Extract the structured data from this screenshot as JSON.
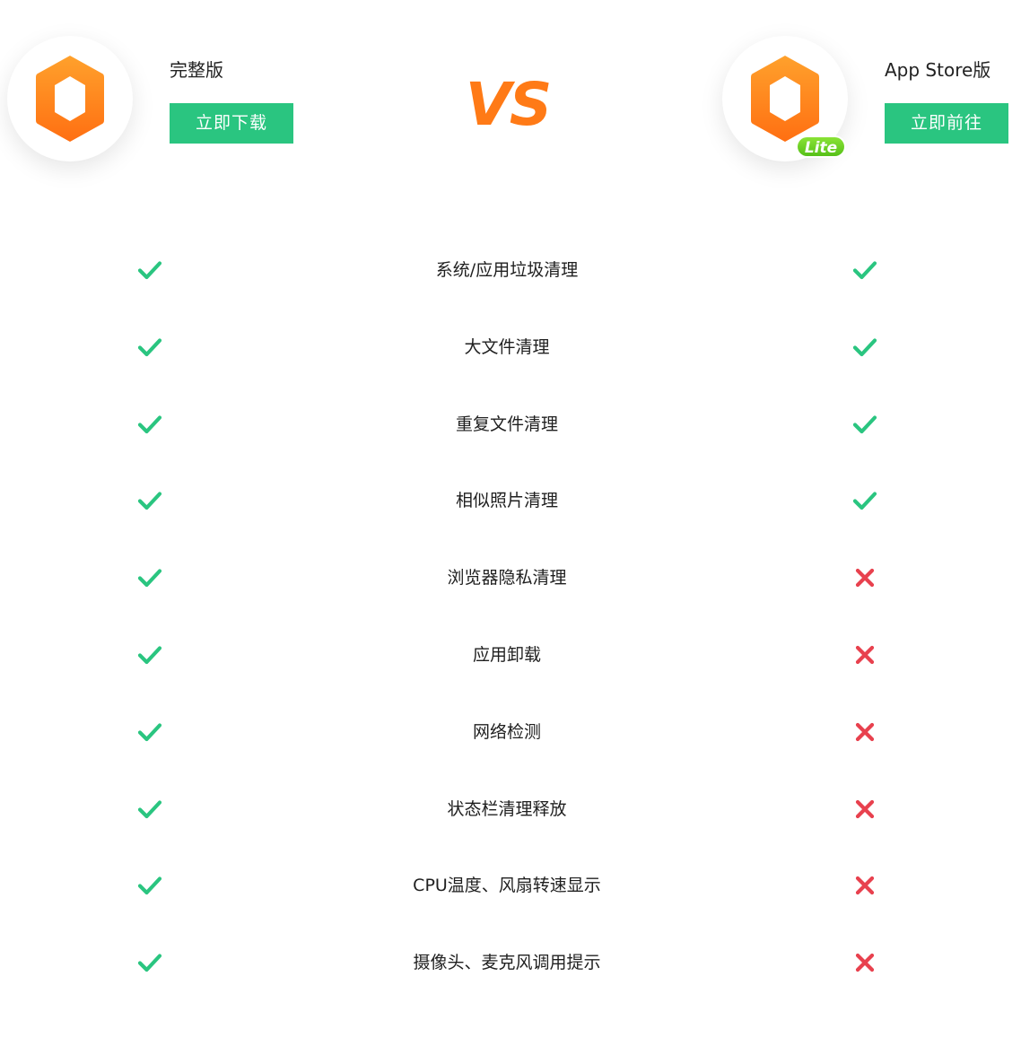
{
  "colors": {
    "accent_green": "#2ac580",
    "vs_orange": "#ff7a16",
    "check_green": "#2ac580",
    "cross_red": "#e8414e",
    "logo_orange_top": "#ffa12c",
    "logo_orange_bottom": "#ff6f12",
    "lite_badge_green": "#6fd321"
  },
  "full_edition": {
    "title": "完整版",
    "button_label": "立即下载",
    "logo_icon": "hexagon-logo-icon"
  },
  "vs_label": "VS",
  "lite_edition": {
    "title": "App Store版",
    "button_label": "立即前往",
    "logo_icon": "hexagon-logo-icon",
    "badge": "Lite"
  },
  "features": [
    {
      "label": "系统/应用垃圾清理",
      "full": "check",
      "lite": "check"
    },
    {
      "label": "大文件清理",
      "full": "check",
      "lite": "check"
    },
    {
      "label": "重复文件清理",
      "full": "check",
      "lite": "check"
    },
    {
      "label": "相似照片清理",
      "full": "check",
      "lite": "check"
    },
    {
      "label": "浏览器隐私清理",
      "full": "check",
      "lite": "cross"
    },
    {
      "label": "应用卸载",
      "full": "check",
      "lite": "cross"
    },
    {
      "label": "网络检测",
      "full": "check",
      "lite": "cross"
    },
    {
      "label": "状态栏清理释放",
      "full": "check",
      "lite": "cross"
    },
    {
      "label": "CPU温度、风扇转速显示",
      "full": "check",
      "lite": "cross"
    },
    {
      "label": "摄像头、麦克风调用提示",
      "full": "check",
      "lite": "cross"
    }
  ]
}
